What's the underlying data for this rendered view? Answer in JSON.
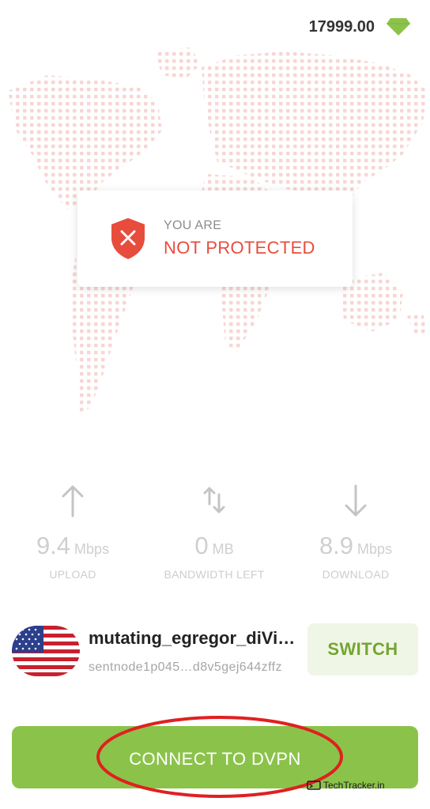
{
  "header": {
    "balance": "17999.00",
    "balance_icon": "gem-icon"
  },
  "colors": {
    "accent_green": "#8bc34a",
    "danger_red": "#e84c3d",
    "map_dot": "#f7d6d3"
  },
  "status": {
    "line1": "YOU ARE",
    "line2": "NOT PROTECTED",
    "icon": "shield-x-icon"
  },
  "stats": {
    "upload": {
      "value": "9.4",
      "unit": "Mbps",
      "label": "UPLOAD",
      "icon": "arrow-up-icon"
    },
    "bandwidth": {
      "value": "0",
      "unit": "MB",
      "label": "BANDWIDTH LEFT",
      "icon": "arrows-up-down-icon"
    },
    "download": {
      "value": "8.9",
      "unit": "Mbps",
      "label": "DOWNLOAD",
      "icon": "arrow-down-icon"
    }
  },
  "node": {
    "name": "mutating_egregor_diVi…",
    "address": "sentnode1p045…d8v5gej644zffz",
    "flag": "us-flag-icon",
    "switch_label": "SWITCH"
  },
  "connect": {
    "label": "CONNECT TO DVPN"
  },
  "watermark": {
    "text": "TechTracker.in"
  }
}
